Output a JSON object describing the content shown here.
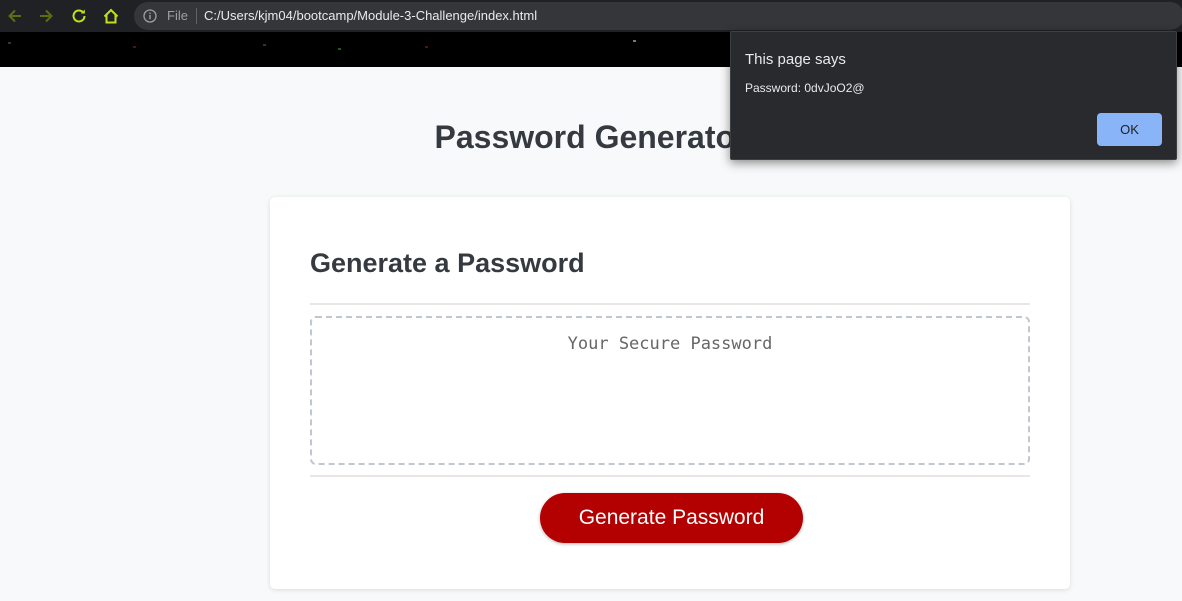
{
  "browser": {
    "scheme_label": "File",
    "url": "C:/Users/kjm04/bootcamp/Module-3-Challenge/index.html",
    "icons": {
      "back": "arrow-left",
      "forward": "arrow-right",
      "reload": "reload",
      "home": "home",
      "info": "info-circle"
    },
    "accent_color": "#c5e01a"
  },
  "page": {
    "title": "Password Generator",
    "card": {
      "header": "Generate a Password",
      "password_placeholder": "Your Secure Password",
      "password_value": "",
      "generate_button_label": "Generate Password"
    },
    "colors": {
      "background": "#f8f9fa",
      "button": "#b30000",
      "text": "#343a40"
    }
  },
  "dialog": {
    "title": "This page says",
    "message": "Password: 0dvJoO2@",
    "ok_label": "OK",
    "ok_color": "#8ab4f8"
  }
}
